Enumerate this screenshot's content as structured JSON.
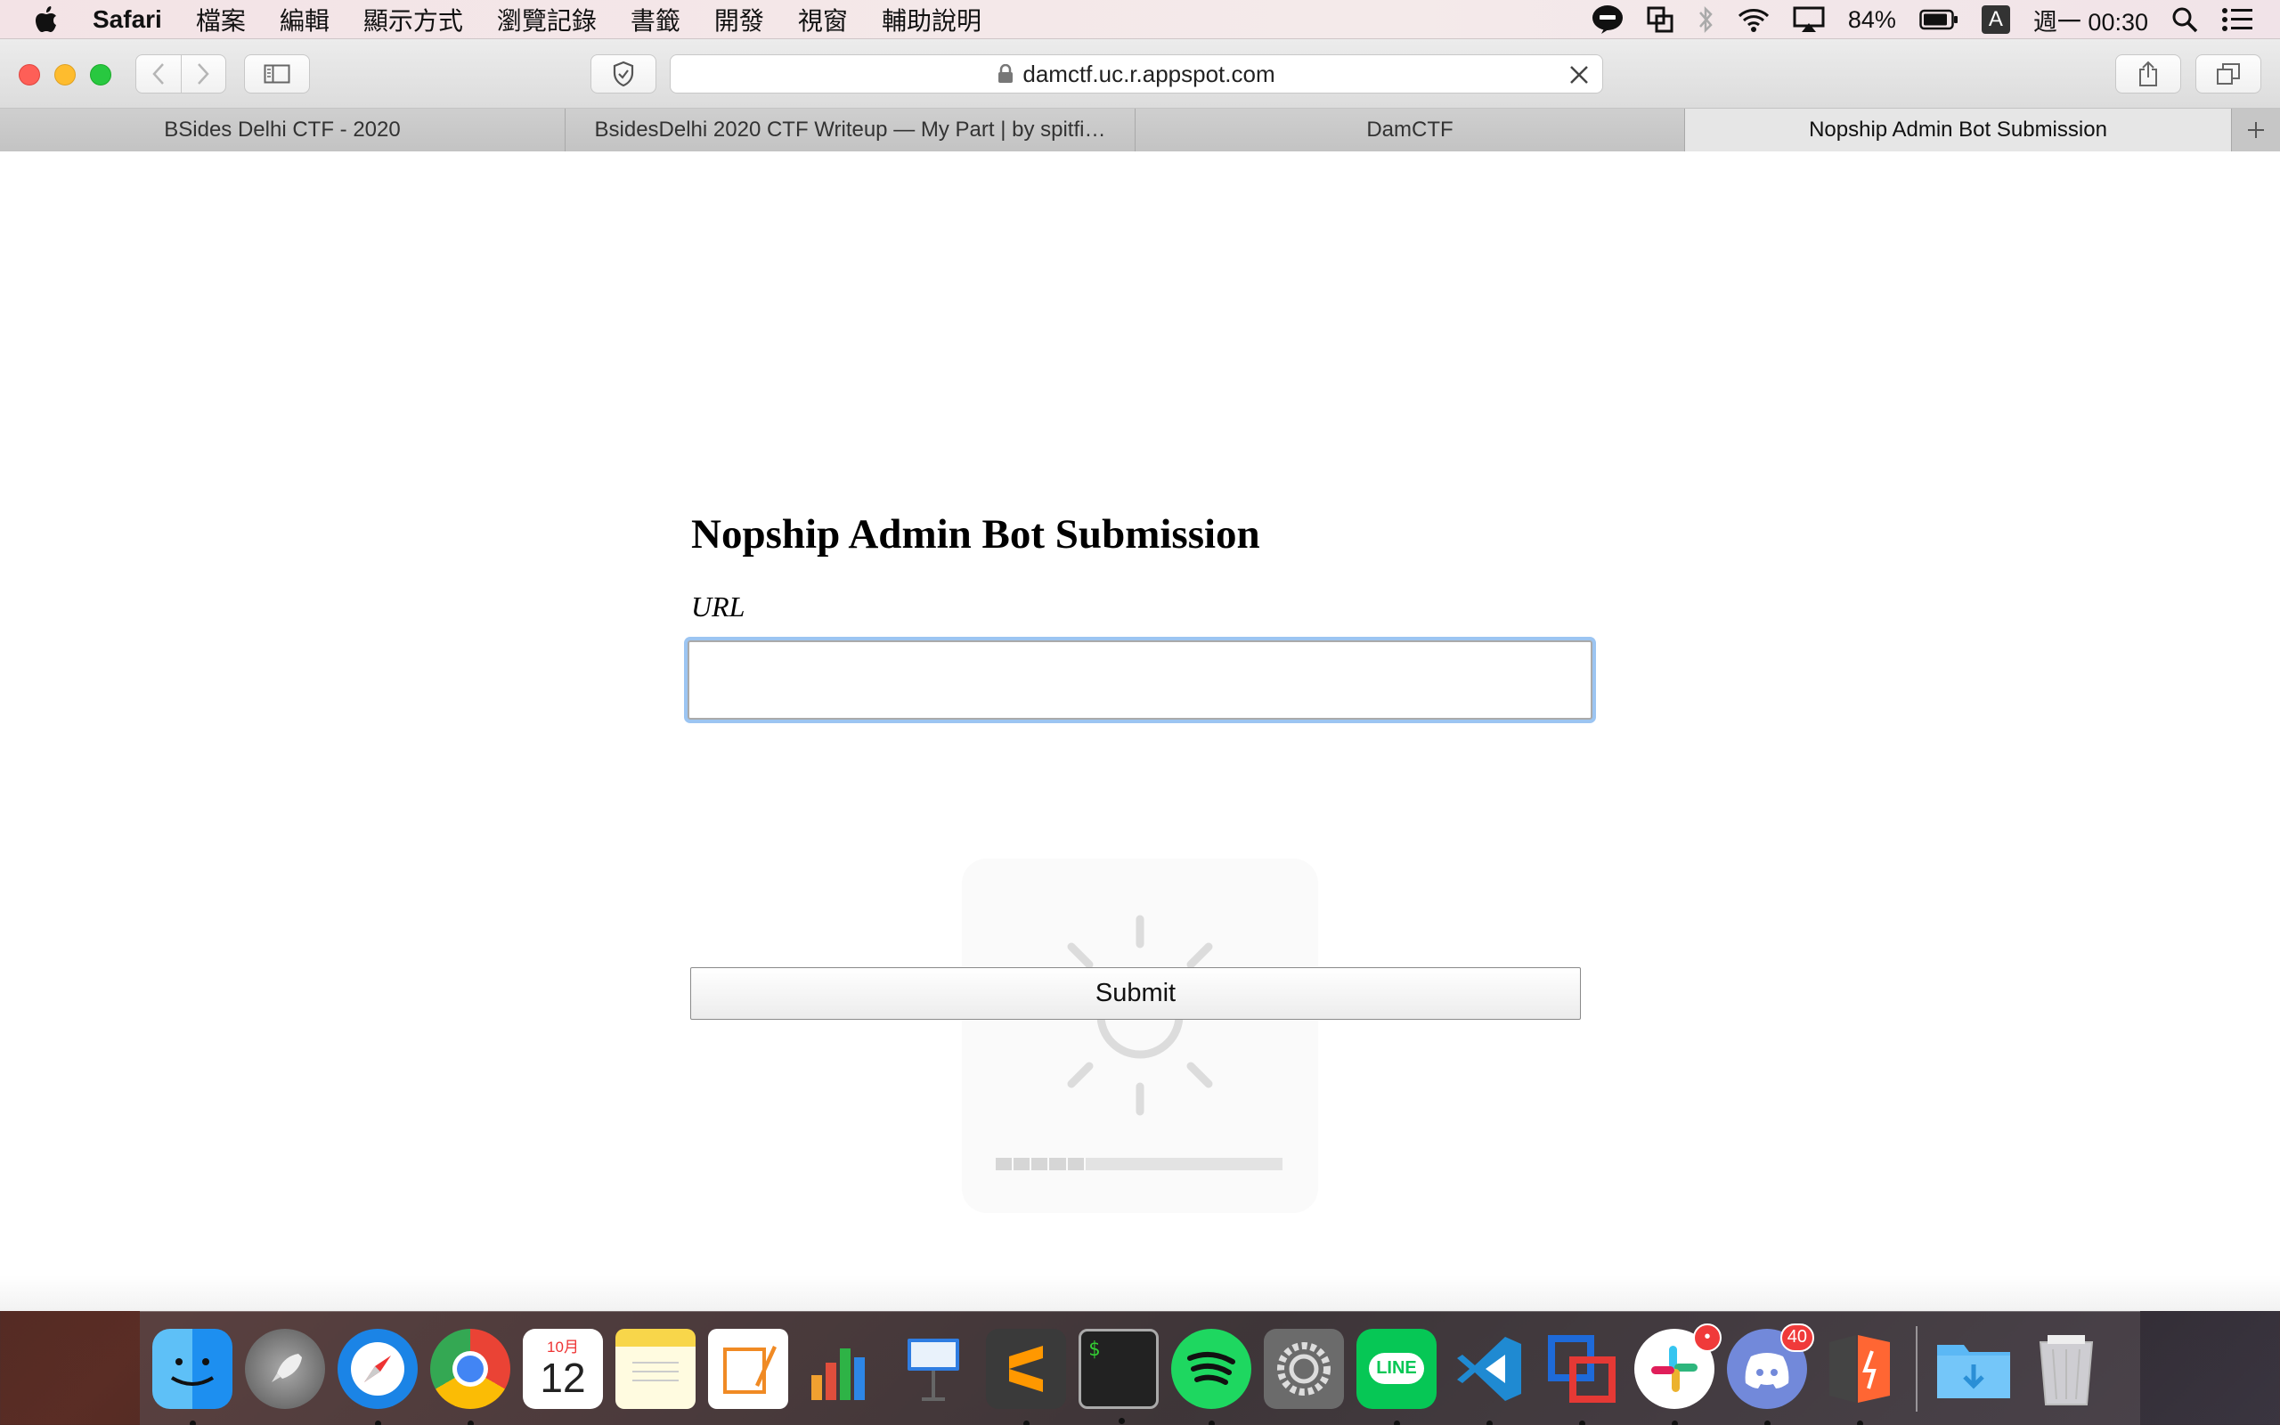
{
  "menubar": {
    "app_name": "Safari",
    "items": [
      "檔案",
      "編輯",
      "顯示方式",
      "瀏覽記錄",
      "書籤",
      "開發",
      "視窗",
      "輔助說明"
    ],
    "battery": "84%",
    "input_method": "A",
    "clock": "週一 00:30"
  },
  "toolbar": {
    "address": "damctf.uc.r.appspot.com"
  },
  "tabs": [
    {
      "title": "BSides Delhi CTF - 2020"
    },
    {
      "title": "BsidesDelhi 2020 CTF Writeup — My Part | by spitfi…"
    },
    {
      "title": "DamCTF"
    },
    {
      "title": "Nopship Admin Bot Submission"
    }
  ],
  "page": {
    "title": "Nopship Admin Bot Submission",
    "url_label": "URL",
    "url_value": "",
    "submit_label": "Submit",
    "brightness_level": 0.3
  },
  "dock": {
    "calendar_month": "10月",
    "calendar_day": "12",
    "terminal_prompt": "$",
    "line_label": "LINE",
    "slack_badge": "•",
    "discord_badge": "40"
  },
  "colors": {
    "focus_ring": "#9cc5f2",
    "close": "#fe5f57",
    "minimize": "#febc2e",
    "maximize": "#28c840"
  }
}
